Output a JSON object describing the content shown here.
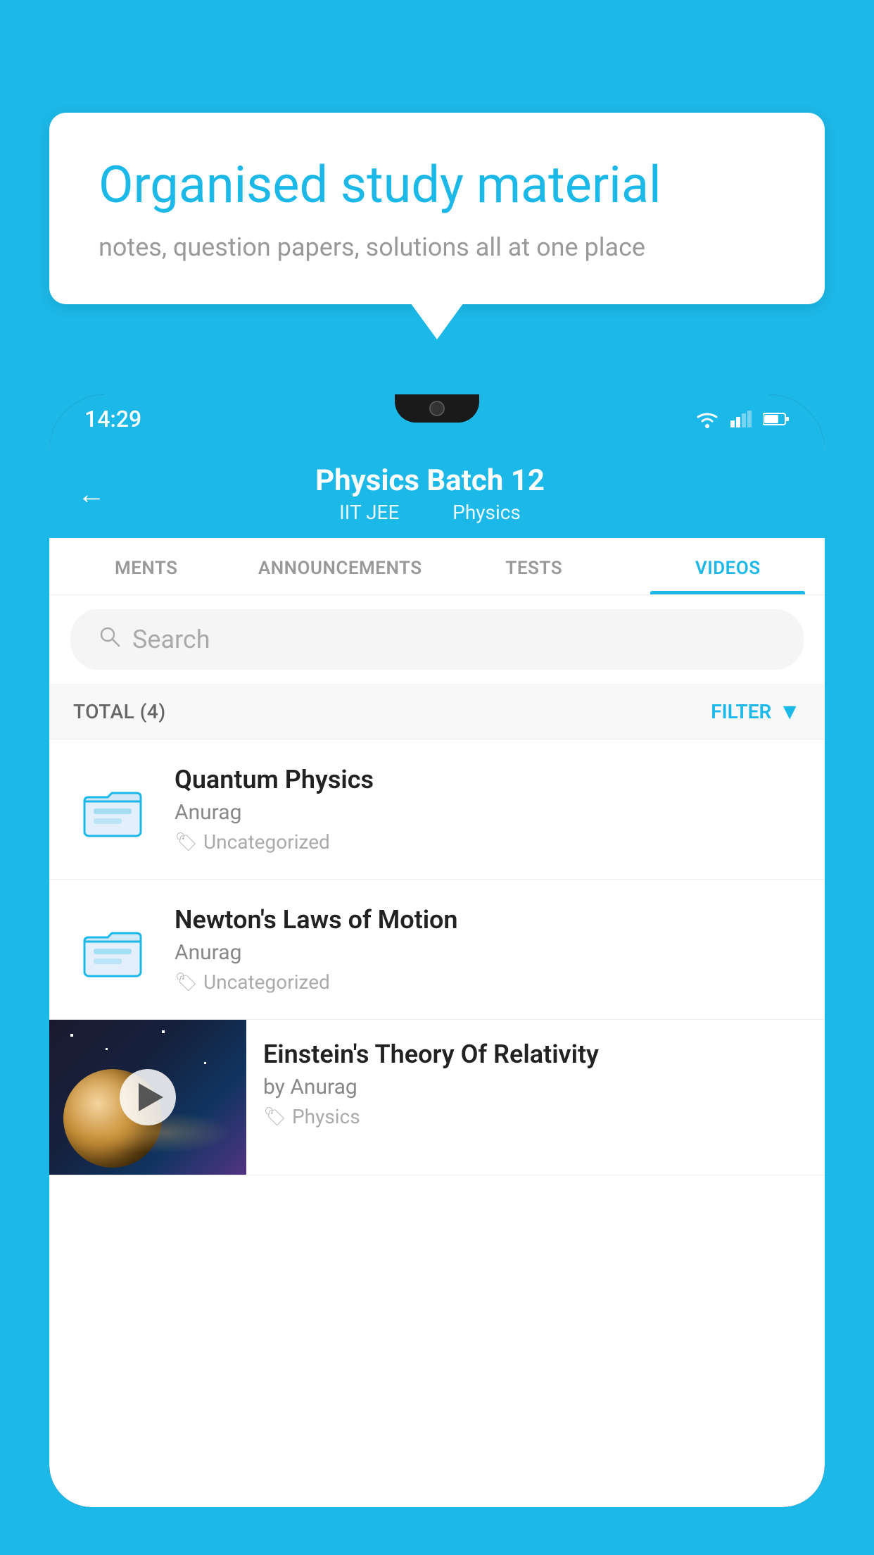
{
  "background_color": "#1cb8e8",
  "bubble": {
    "title": "Organised study material",
    "subtitle": "notes, question papers, solutions all at one place"
  },
  "phone": {
    "status_bar": {
      "time": "14:29"
    },
    "header": {
      "back_label": "←",
      "title": "Physics Batch 12",
      "subtitle_part1": "IIT JEE",
      "subtitle_part2": "Physics"
    },
    "tabs": [
      {
        "label": "MENTS",
        "active": false
      },
      {
        "label": "ANNOUNCEMENTS",
        "active": false
      },
      {
        "label": "TESTS",
        "active": false
      },
      {
        "label": "VIDEOS",
        "active": true
      }
    ],
    "search": {
      "placeholder": "Search"
    },
    "filter_row": {
      "total_label": "TOTAL (4)",
      "filter_label": "FILTER"
    },
    "video_items": [
      {
        "title": "Quantum Physics",
        "author": "Anurag",
        "tag": "Uncategorized",
        "has_thumbnail": false
      },
      {
        "title": "Newton's Laws of Motion",
        "author": "Anurag",
        "tag": "Uncategorized",
        "has_thumbnail": false
      },
      {
        "title": "Einstein's Theory Of Relativity",
        "author": "by Anurag",
        "tag": "Physics",
        "has_thumbnail": true
      }
    ]
  }
}
